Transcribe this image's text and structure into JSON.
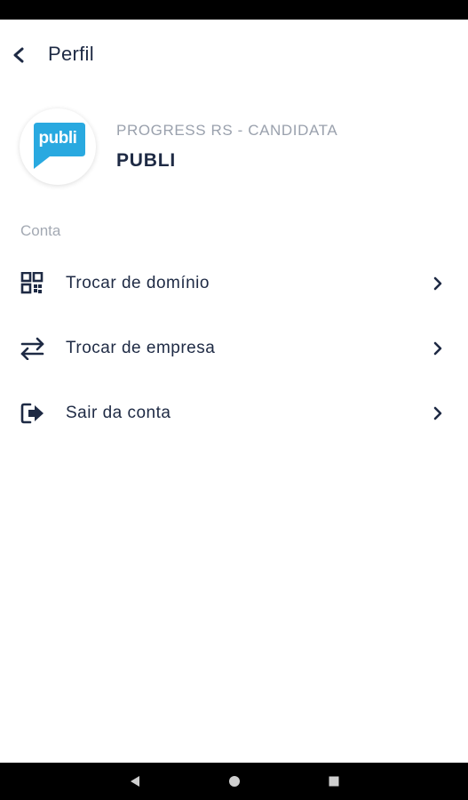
{
  "app_bar": {
    "title": "Perfil"
  },
  "profile": {
    "logo_text": "publi",
    "subtitle": "PROGRESS RS - CANDIDATA",
    "name": "PUBLI",
    "logo_color": "#29a9e0"
  },
  "section": {
    "label": "Conta"
  },
  "menu": [
    {
      "label": "Trocar de domínio",
      "icon": "qr-code-icon"
    },
    {
      "label": "Trocar de empresa",
      "icon": "swap-arrows-icon"
    },
    {
      "label": "Sair da conta",
      "icon": "logout-icon"
    }
  ],
  "colors": {
    "text": "#1e2a44",
    "muted": "#9aa1ad",
    "accent": "#29a9e0"
  },
  "nav_bar": {
    "icons": [
      "back-triangle-icon",
      "home-circle-icon",
      "recents-square-icon"
    ]
  }
}
